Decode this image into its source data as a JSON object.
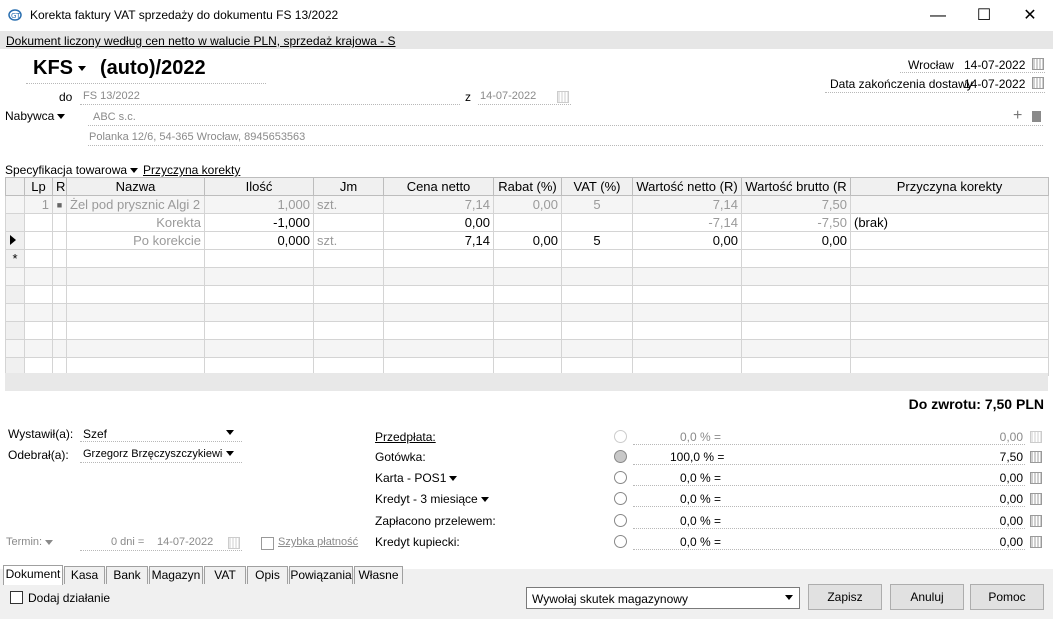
{
  "window": {
    "title": "Korekta faktury VAT sprzedaży do dokumentu FS 13/2022",
    "minimize": "—",
    "maximize": "☐",
    "close": "✕"
  },
  "info_bar": "Dokument liczony według cen netto w walucie PLN, sprzedaż krajowa - S",
  "header": {
    "doc_type": "KFS",
    "doc_number": "(auto)/2022",
    "city": "Wrocław",
    "issue_date": "14-07-2022",
    "delivery_label": "Data zakończenia dostawy",
    "delivery_date": "14-07-2022",
    "do_label": "do",
    "do_value": "FS 13/2022",
    "z_label": "z",
    "z_date": "14-07-2022",
    "buyer_label": "Nabywca",
    "buyer_name": "ABC s.c.",
    "buyer_address": "Polanka 12/6, 54-365 Wrocław, 8945653563",
    "plus": "+"
  },
  "spec_tabs": {
    "spec": "Specyfikacja towarowa",
    "reason": "Przyczyna korekty"
  },
  "grid": {
    "columns": [
      "Lp",
      "R",
      "Nazwa",
      "Ilość",
      "Jm",
      "Cena netto",
      "Rabat (%)",
      "VAT (%)",
      "Wartość netto (R)",
      "Wartość brutto (R",
      "Przyczyna korekty"
    ],
    "rows": [
      {
        "lp": "1",
        "r": "■",
        "name": "Żel pod prysznic Algi 2",
        "qty": "1,000",
        "jm": "szt.",
        "price": "7,14",
        "rabat": "0,00",
        "vat": "5",
        "netto": "7,14",
        "brutto": "7,50",
        "reason": ""
      },
      {
        "lp": "",
        "r": "",
        "name": "Korekta",
        "qty": "-1,000",
        "jm": "",
        "price": "0,00",
        "rabat": "",
        "vat": "",
        "netto": "-7,14",
        "brutto": "-7,50",
        "reason": "(brak)"
      },
      {
        "lp": "",
        "r": "",
        "name": "Po korekcie",
        "qty": "0,000",
        "jm": "szt.",
        "price": "7,14",
        "rabat": "0,00",
        "vat": "5",
        "netto": "0,00",
        "brutto": "0,00",
        "reason": ""
      }
    ],
    "new_row_marker": "*"
  },
  "total": "Do zwrotu: 7,50 PLN",
  "people": {
    "issued_label": "Wystawił(a):",
    "issued_value": "Szef",
    "received_label": "Odebrał(a):",
    "received_value": "Grzegorz Brzęczyszczykiewicz"
  },
  "term": {
    "label": "Termin:",
    "days": "0 dni =",
    "date": "14-07-2022",
    "quick_pay": "Szybka płatność"
  },
  "payments": [
    {
      "label": "Przedpłata:",
      "pct": "0,0 % =",
      "amount": "0,00",
      "selected": false
    },
    {
      "label": "Gotówka:",
      "pct": "100,0 % =",
      "amount": "7,50",
      "selected": true
    },
    {
      "label": "Karta - POS1",
      "pct": "0,0 % =",
      "amount": "0,00",
      "selected": false
    },
    {
      "label": "Kredyt - 3 miesiące",
      "pct": "0,0 % =",
      "amount": "0,00",
      "selected": false
    },
    {
      "label": "Zapłacono przelewem:",
      "pct": "0,0 % =",
      "amount": "0,00",
      "selected": false
    },
    {
      "label": "Kredyt kupiecki:",
      "pct": "0,0 % =",
      "amount": "0,00",
      "selected": false
    }
  ],
  "bottom_tabs": [
    "Dokument",
    "Kasa",
    "Bank",
    "Magazyn",
    "VAT",
    "Opis",
    "Powiązania",
    "Własne"
  ],
  "footer": {
    "add_action": "Dodaj działanie",
    "combo": "Wywołaj skutek magazynowy",
    "save": "Zapisz",
    "cancel": "Anuluj",
    "help": "Pomoc"
  }
}
